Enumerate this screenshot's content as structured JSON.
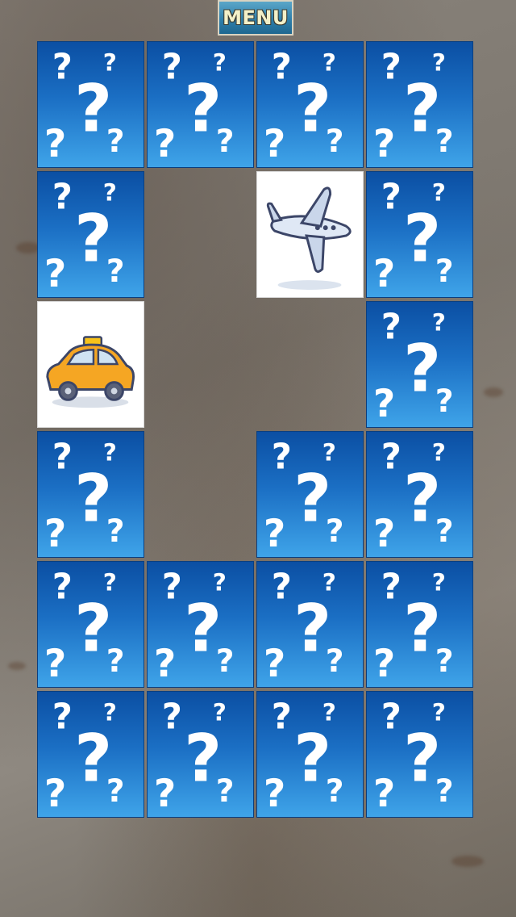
{
  "header": {
    "menu_label": "MENU"
  },
  "board": {
    "columns": 4,
    "rows": 6,
    "cards": [
      {
        "state": "hidden"
      },
      {
        "state": "hidden"
      },
      {
        "state": "hidden"
      },
      {
        "state": "hidden"
      },
      {
        "state": "hidden"
      },
      {
        "state": "removed"
      },
      {
        "state": "revealed",
        "icon": "airplane-icon"
      },
      {
        "state": "hidden"
      },
      {
        "state": "revealed",
        "icon": "taxi-icon"
      },
      {
        "state": "removed"
      },
      {
        "state": "removed"
      },
      {
        "state": "hidden"
      },
      {
        "state": "hidden"
      },
      {
        "state": "removed"
      },
      {
        "state": "hidden"
      },
      {
        "state": "hidden"
      },
      {
        "state": "hidden"
      },
      {
        "state": "hidden"
      },
      {
        "state": "hidden"
      },
      {
        "state": "hidden"
      },
      {
        "state": "hidden"
      },
      {
        "state": "hidden"
      },
      {
        "state": "hidden"
      },
      {
        "state": "hidden"
      }
    ]
  },
  "colors": {
    "card_back_top": "#0b4fa3",
    "card_back_bottom": "#3fa4e9",
    "taxi_body": "#f5a623",
    "airplane_body": "#dfe8f5"
  }
}
